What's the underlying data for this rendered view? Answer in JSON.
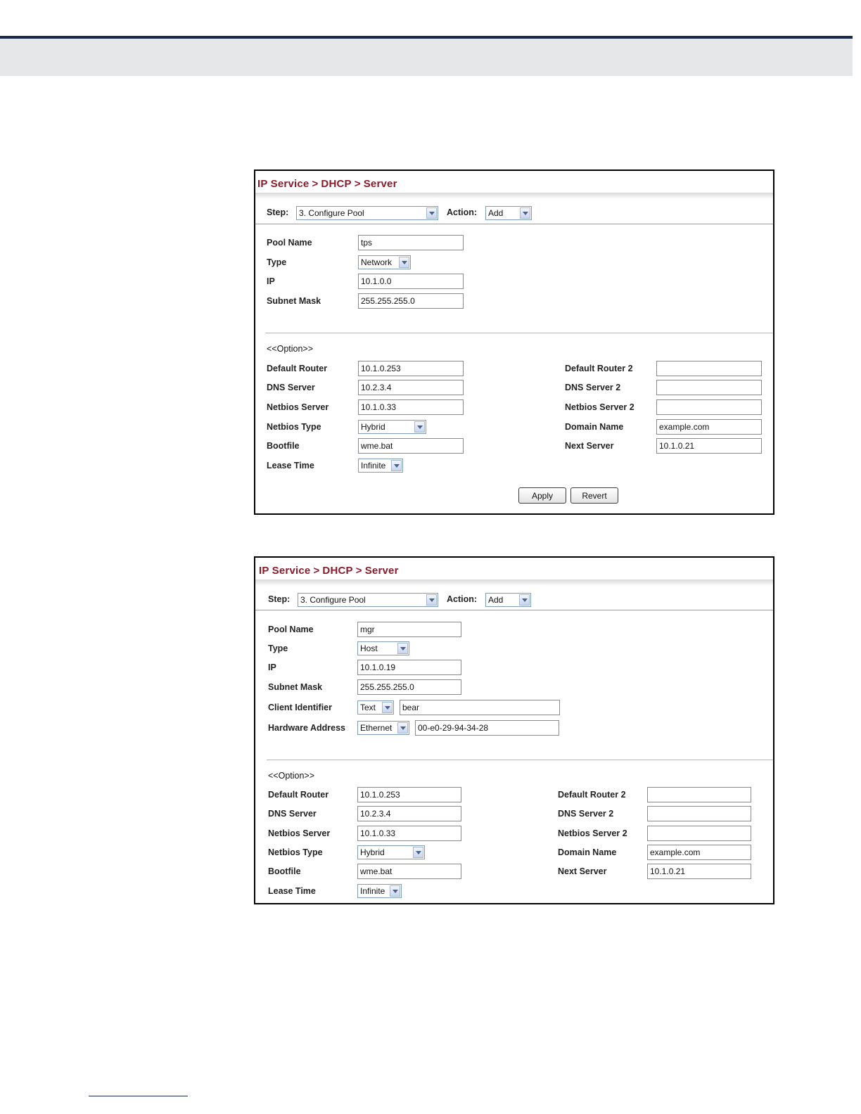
{
  "panels": [
    {
      "breadcrumb": [
        "IP Service",
        "DHCP",
        "Server"
      ],
      "breadcrumb_sep": ">",
      "step": {
        "label": "Step:",
        "value": "3. Configure Pool"
      },
      "action": {
        "label": "Action:",
        "value": "Add"
      },
      "fields": {
        "pool_name": {
          "label": "Pool Name",
          "value": "tps"
        },
        "type": {
          "label": "Type",
          "value": "Network"
        },
        "ip": {
          "label": "IP",
          "value": "10.1.0.0"
        },
        "subnet_mask": {
          "label": "Subnet Mask",
          "value": "255.255.255.0"
        }
      },
      "option_header": "<<Option>>",
      "options_left": {
        "default_router": {
          "label": "Default Router",
          "value": "10.1.0.253"
        },
        "dns_server": {
          "label": "DNS Server",
          "value": "10.2.3.4"
        },
        "netbios_server": {
          "label": "Netbios Server",
          "value": "10.1.0.33"
        },
        "netbios_type": {
          "label": "Netbios Type",
          "value": "Hybrid"
        },
        "bootfile": {
          "label": "Bootfile",
          "value": "wme.bat"
        },
        "lease_time": {
          "label": "Lease Time",
          "value": "Infinite"
        }
      },
      "options_right": {
        "default_router_2": {
          "label": "Default Router 2",
          "value": ""
        },
        "dns_server_2": {
          "label": "DNS Server 2",
          "value": ""
        },
        "netbios_server_2": {
          "label": "Netbios Server 2",
          "value": ""
        },
        "domain_name": {
          "label": "Domain Name",
          "value": "example.com"
        },
        "next_server": {
          "label": "Next Server",
          "value": "10.1.0.21"
        }
      },
      "buttons": {
        "apply": "Apply",
        "revert": "Revert"
      }
    },
    {
      "breadcrumb": [
        "IP Service",
        "DHCP",
        "Server"
      ],
      "breadcrumb_sep": ">",
      "step": {
        "label": "Step:",
        "value": "3. Configure Pool"
      },
      "action": {
        "label": "Action:",
        "value": "Add"
      },
      "fields": {
        "pool_name": {
          "label": "Pool Name",
          "value": "mgr"
        },
        "type": {
          "label": "Type",
          "value": "Host"
        },
        "ip": {
          "label": "IP",
          "value": "10.1.0.19"
        },
        "subnet_mask": {
          "label": "Subnet Mask",
          "value": "255.255.255.0"
        },
        "client_identifier": {
          "label": "Client Identifier",
          "type": "Text",
          "value": "bear"
        },
        "hardware_address": {
          "label": "Hardware Address",
          "type": "Ethernet",
          "value": "00-e0-29-94-34-28"
        }
      },
      "option_header": "<<Option>>",
      "options_left": {
        "default_router": {
          "label": "Default Router",
          "value": "10.1.0.253"
        },
        "dns_server": {
          "label": "DNS Server",
          "value": "10.2.3.4"
        },
        "netbios_server": {
          "label": "Netbios Server",
          "value": "10.1.0.33"
        },
        "netbios_type": {
          "label": "Netbios Type",
          "value": "Hybrid"
        },
        "bootfile": {
          "label": "Bootfile",
          "value": "wme.bat"
        },
        "lease_time": {
          "label": "Lease Time",
          "value": "Infinite"
        }
      },
      "options_right": {
        "default_router_2": {
          "label": "Default Router 2",
          "value": ""
        },
        "dns_server_2": {
          "label": "DNS Server 2",
          "value": ""
        },
        "netbios_server_2": {
          "label": "Netbios Server 2",
          "value": ""
        },
        "domain_name": {
          "label": "Domain Name",
          "value": "example.com"
        },
        "next_server": {
          "label": "Next Server",
          "value": "10.1.0.21"
        }
      }
    }
  ]
}
